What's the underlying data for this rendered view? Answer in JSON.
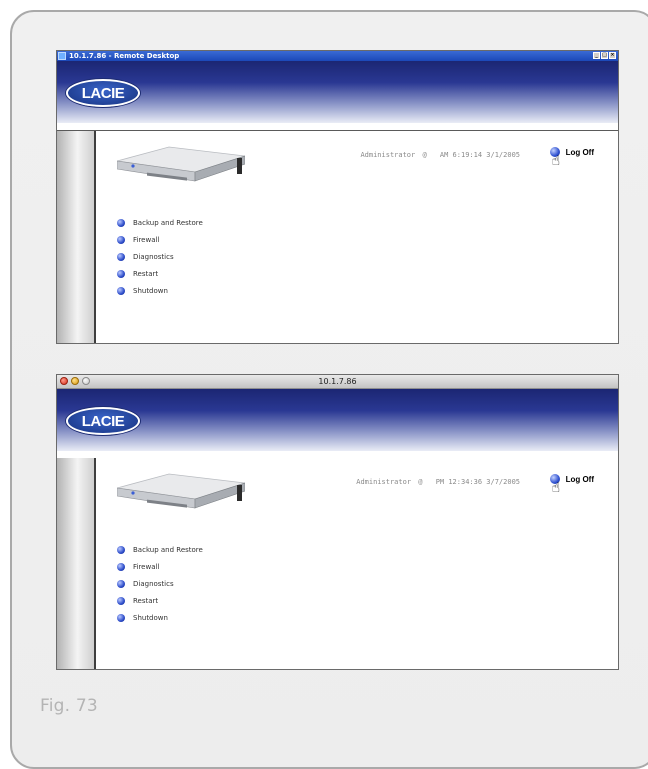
{
  "figure_caption": "Fig. 73",
  "windows": [
    {
      "type": "windows-remote-desktop",
      "title": "10.1.7.86 - Remote Desktop",
      "window_controls": [
        "_",
        "□",
        "×"
      ],
      "logo_text": "LACIE",
      "status": {
        "user": "Administrator",
        "at": "@",
        "time": "AM 6:19:14",
        "date": "3/1/2005"
      },
      "logoff_label": "Log Off",
      "menu": [
        "Backup and Restore",
        "Firewall",
        "Diagnostics",
        "Restart",
        "Shutdown"
      ]
    },
    {
      "type": "mac-browser",
      "title": "10.1.7.86",
      "logo_text": "LACIE",
      "status": {
        "user": "Administrator",
        "at": "@",
        "time": "PM 12:34:36",
        "date": "3/7/2005"
      },
      "logoff_label": "Log Off",
      "menu": [
        "Backup and Restore",
        "Firewall",
        "Diagnostics",
        "Restart",
        "Shutdown"
      ]
    }
  ]
}
